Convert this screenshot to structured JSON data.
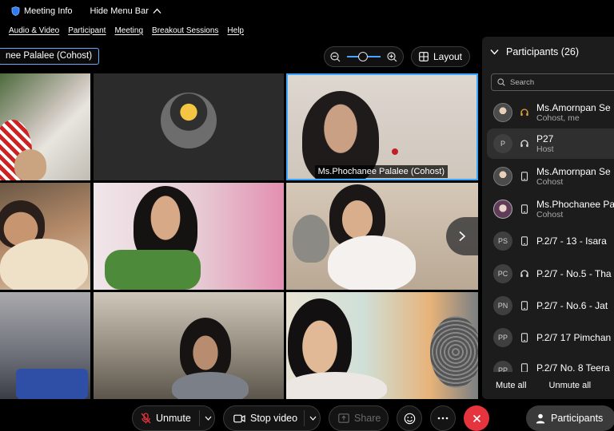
{
  "topbar": {
    "meeting_info": "Meeting Info",
    "hide_menu": "Hide Menu Bar"
  },
  "menu": [
    "Audio & Video",
    "Participant",
    "Meeting",
    "Breakout Sessions",
    "Help"
  ],
  "active_speaker": "nee Palalee (Cohost)",
  "layout_label": "Layout",
  "grid": {
    "highlighted_name": "Ms.Phochanee Palalee (Cohost)"
  },
  "panel": {
    "title": "Participants (26)",
    "search_placeholder": "Search",
    "participants": [
      {
        "initials": "",
        "name": "Ms.Amornpan Se",
        "role": "Cohost, me",
        "status": "headset"
      },
      {
        "initials": "P",
        "name": "P27",
        "role": "Host",
        "status": "headset"
      },
      {
        "initials": "",
        "name": "Ms.Amornpan Se",
        "role": "Cohost",
        "status": "phone"
      },
      {
        "initials": "",
        "name": "Ms.Phochanee Pa",
        "role": "Cohost",
        "status": "phone"
      },
      {
        "initials": "PS",
        "name": "P.2/7 - 13 - Isara",
        "role": "",
        "status": "phone"
      },
      {
        "initials": "PC",
        "name": "P.2/7 - No.5 - Tha",
        "role": "",
        "status": "headset"
      },
      {
        "initials": "PN",
        "name": "P.2/7 - No.6 - Jat",
        "role": "",
        "status": "phone"
      },
      {
        "initials": "PP",
        "name": "P.2/7 17 Pimchan",
        "role": "",
        "status": "phone"
      },
      {
        "initials": "PP",
        "name": "P.2/7 No. 8 Teera",
        "role": "",
        "status": "phone"
      }
    ],
    "mute_all": "Mute all",
    "unmute_all": "Unmute all"
  },
  "controls": {
    "unmute": "Unmute",
    "stop_video": "Stop video",
    "share": "Share",
    "participants": "Participants"
  },
  "colors": {
    "accent": "#3aa7ff",
    "end": "#e5343d",
    "mic_muted": "#e5343d"
  }
}
